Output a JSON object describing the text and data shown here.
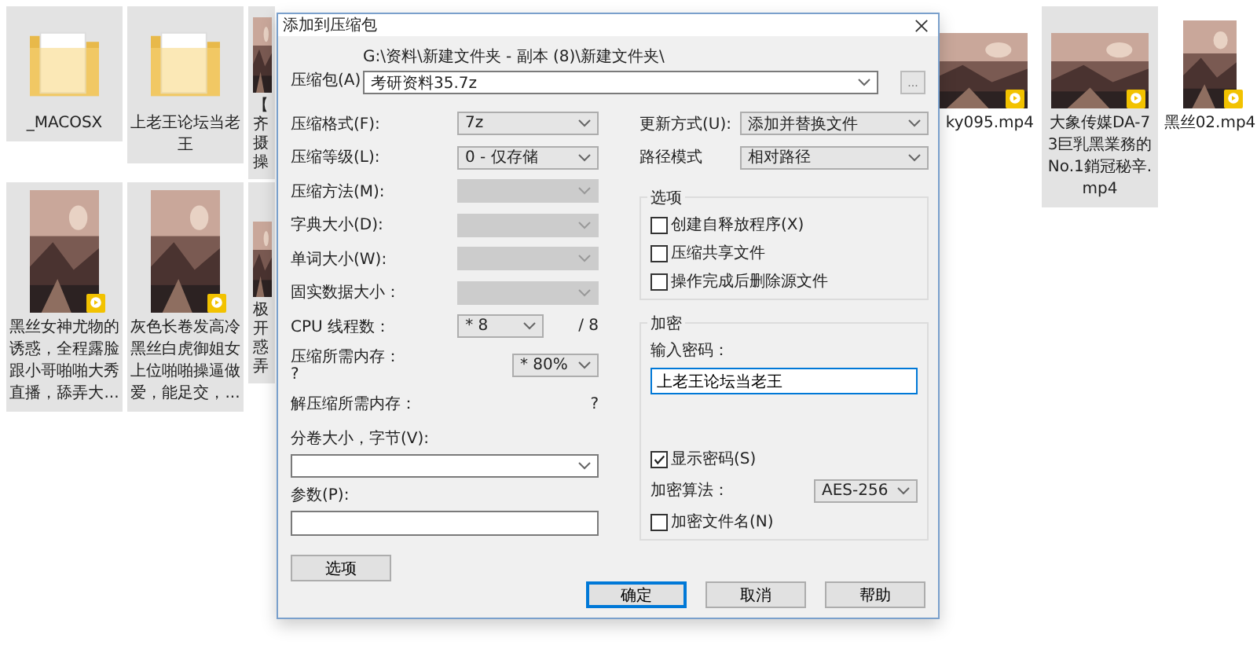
{
  "explorer": {
    "rows": [
      [
        {
          "name": "_MACOSX",
          "kind": "folder",
          "selected": true
        },
        {
          "name": "上老王论坛当老王",
          "kind": "folder",
          "selected": true
        },
        {
          "name": "【齐摄操",
          "kind": "partial",
          "selected": true
        },
        {
          "name": "ky095.mp4",
          "kind": "video",
          "selected": false
        },
        {
          "name": "大象传媒DA-73巨乳黑業務的No.1銷冠秘辛.mp4",
          "kind": "video",
          "selected": true
        },
        {
          "name": "黑丝02.mp4",
          "kind": "portrait",
          "selected": false
        }
      ],
      [
        {
          "name": "黑丝女神尤物的诱惑，全程露脸跟小哥啪啪大秀直播，舔弄大...",
          "kind": "portrait",
          "selected": true
        },
        {
          "name": "灰色长卷发高冷黑丝白虎御姐女上位啪啪操逼做爱，能足交，...",
          "kind": "portrait",
          "selected": true
        },
        {
          "name": "极开惑弄",
          "kind": "partial",
          "selected": true
        }
      ]
    ]
  },
  "dialog": {
    "title": "添加到压缩包",
    "archive": {
      "label": "压缩包(A)",
      "path": "G:\\资料\\新建文件夹 - 副本 (8)\\新建文件夹\\",
      "value": "考研资料35.7z",
      "browse": "..."
    },
    "left_rows": [
      {
        "kind": "combo",
        "label": "压缩格式(F):",
        "value": "7z",
        "disabled": false
      },
      {
        "kind": "combo",
        "label": "压缩等级(L):",
        "value": "0 - 仅存储",
        "disabled": false
      },
      {
        "kind": "combo",
        "label": "压缩方法(M):",
        "disabled": true
      },
      {
        "kind": "combo",
        "label": "字典大小(D):",
        "disabled": true
      },
      {
        "kind": "combo",
        "label": "单词大小(W):",
        "disabled": true
      },
      {
        "kind": "combo",
        "label": "固实数据大小：",
        "disabled": true
      },
      {
        "kind": "threads",
        "label": "CPU 线程数：",
        "value": "* 8",
        "suffix": "/ 8"
      },
      {
        "kind": "memory",
        "label": "压缩所需内存：",
        "note": "?",
        "value": "* 80%"
      },
      {
        "kind": "info",
        "label": "解压缩所需内存：",
        "note": "?"
      }
    ],
    "split": {
      "label": "分卷大小，字节(V):"
    },
    "params": {
      "label": "参数(P):"
    },
    "options_button": "选项",
    "update": {
      "label": "更新方式(U):",
      "value": "添加并替换文件"
    },
    "path_mode": {
      "label": "路径模式",
      "value": "相对路径"
    },
    "options": {
      "title": "选项",
      "items": [
        {
          "label": "创建自释放程序(X)",
          "checked": false
        },
        {
          "label": "压缩共享文件",
          "checked": false
        },
        {
          "label": "操作完成后删除源文件",
          "checked": false
        }
      ]
    },
    "encryption": {
      "title": "加密",
      "password_label": "输入密码：",
      "password": "上老王论坛当老王",
      "show_password": {
        "label": "显示密码(S)",
        "checked": true
      },
      "method_label": "加密算法：",
      "method": "AES-256",
      "encrypt_names": {
        "label": "加密文件名(N)",
        "checked": false
      }
    },
    "buttons": [
      {
        "label": "确定",
        "default": true
      },
      {
        "label": "取消",
        "default": false
      },
      {
        "label": "帮助",
        "default": false
      }
    ]
  }
}
